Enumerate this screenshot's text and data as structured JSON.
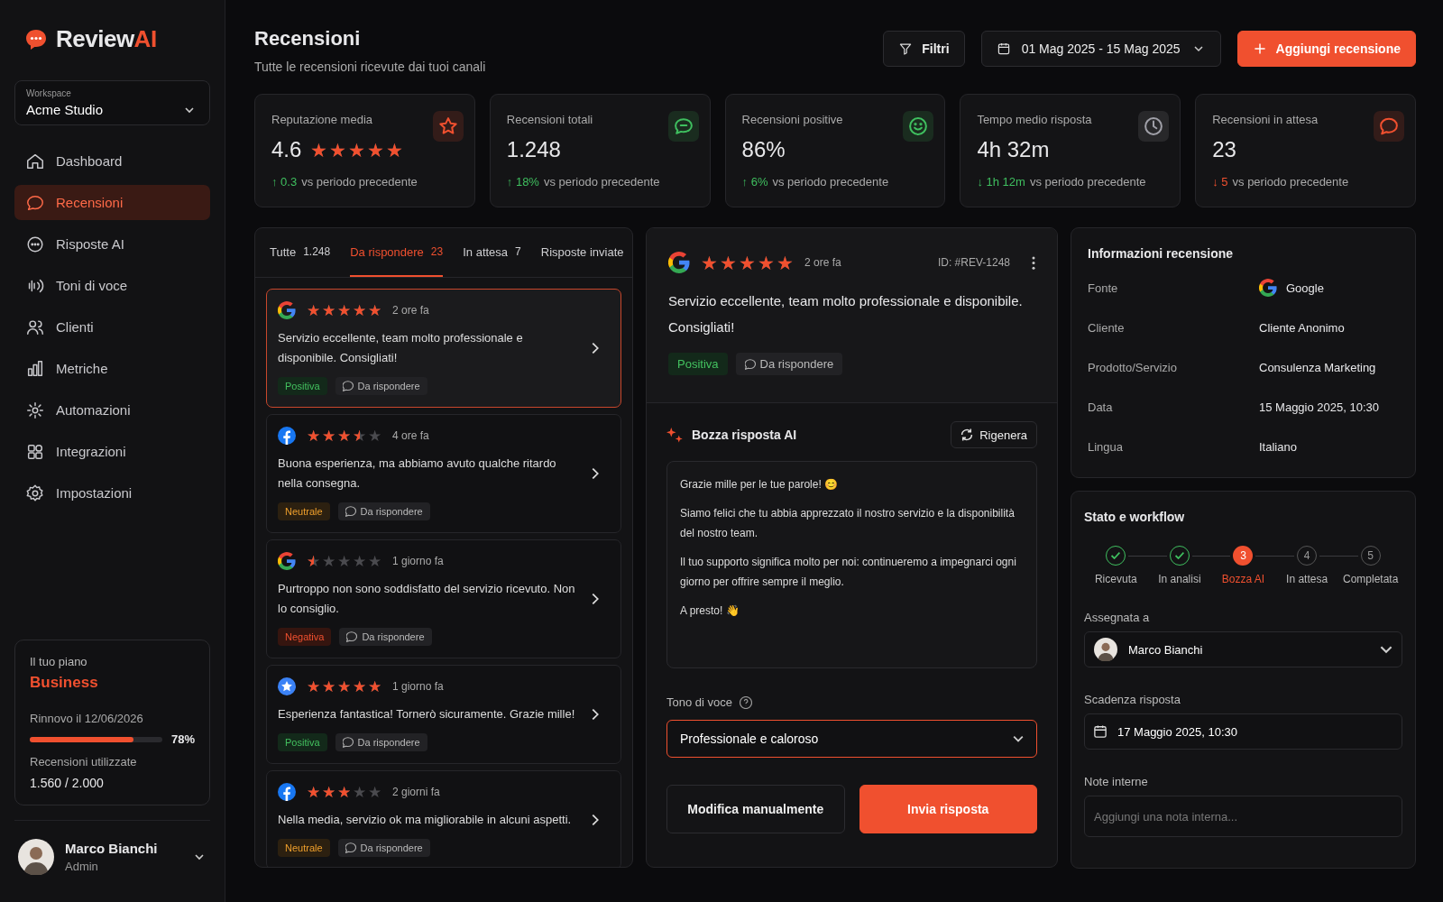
{
  "brand": {
    "name": "Review",
    "accent": "AI"
  },
  "workspace": {
    "label": "Workspace",
    "value": "Acme Studio"
  },
  "nav": [
    {
      "label": "Dashboard",
      "selected": false
    },
    {
      "label": "Recensioni",
      "selected": true
    },
    {
      "label": "Risposte AI",
      "selected": false
    },
    {
      "label": "Toni di voce",
      "selected": false
    },
    {
      "label": "Clienti",
      "selected": false
    },
    {
      "label": "Metriche",
      "selected": false
    },
    {
      "label": "Automazioni",
      "selected": false
    },
    {
      "label": "Integrazioni",
      "selected": false
    },
    {
      "label": "Impostazioni",
      "selected": false
    }
  ],
  "plan": {
    "label": "Il tuo piano",
    "name": "Business",
    "renewal": "Rinnovo il 12/06/2026",
    "level": 0.78,
    "percent": "78%",
    "usage_label": "Recensioni utilizzate",
    "usage": "1.560 / 2.000"
  },
  "user": {
    "name": "Marco Bianchi",
    "role": "Admin"
  },
  "header": {
    "title": "Recensioni",
    "subtitle": "Tutte le recensioni ricevute dai tuoi canali",
    "filter": "Filtri",
    "date_range": "01 Mag 2025 - 15 Mag 2025",
    "add": "Aggiungi recensione"
  },
  "stats": [
    {
      "label": "Reputazione media",
      "value": "4.6",
      "stars": 5,
      "icon": {
        "color": "#f0502f"
      },
      "delta": {
        "arrow": "↑",
        "text": "0.3",
        "color": "#3fbf5f"
      },
      "note": "vs periodo precedente"
    },
    {
      "label": "Recensioni totali",
      "value": "1.248",
      "icon": {
        "color": "#3fbf5f"
      },
      "delta": {
        "arrow": "↑",
        "text": "18%",
        "color": "#3fbf5f"
      },
      "note": "vs periodo precedente"
    },
    {
      "label": "Recensioni positive",
      "value": "86%",
      "icon": {
        "color": "#3fbf5f"
      },
      "delta": {
        "arrow": "↑",
        "text": "6%",
        "color": "#3fbf5f"
      },
      "note": "vs periodo precedente"
    },
    {
      "label": "Tempo medio risposta",
      "value": "4h 32m",
      "icon": {
        "color": "#a0a0a8"
      },
      "delta": {
        "arrow": "↓",
        "text": "1h 12m",
        "color": "#3fbf5f"
      },
      "note": "vs periodo precedente"
    },
    {
      "label": "Recensioni in attesa",
      "value": "23",
      "icon": {
        "color": "#f0502f"
      },
      "delta": {
        "arrow": "↓",
        "text": "5",
        "color": "#f0502f"
      },
      "note": "vs periodo precedente"
    }
  ],
  "tabs": [
    {
      "label": "Tutte",
      "count": "1.248",
      "selected": false
    },
    {
      "label": "Da rispondere",
      "count": "23",
      "selected": true
    },
    {
      "label": "In attesa",
      "count": "7",
      "selected": false
    },
    {
      "label": "Risposte inviate",
      "selected": false
    }
  ],
  "reviews": [
    {
      "source": {
        "kind": "google"
      },
      "stars": 5,
      "time": "2 ore fa",
      "text": "Servizio eccellente, team molto professionale e disponibile. Consigliati!",
      "tag": {
        "kind": "positive",
        "text": "Positiva"
      },
      "status": "Da rispondere",
      "selected": true
    },
    {
      "source": {
        "kind": "facebook"
      },
      "stars": 3.5,
      "time": "4 ore fa",
      "text": "Buona esperienza, ma abbiamo avuto qualche ritardo nella consegna.",
      "tag": {
        "kind": "neutral",
        "text": "Neutrale"
      },
      "status": "Da rispondere",
      "selected": false
    },
    {
      "source": {
        "kind": "google"
      },
      "stars": 0.5,
      "time": "1 giorno fa",
      "text": "Purtroppo non sono soddisfatto del servizio ricevuto. Non lo consiglio.",
      "tag": {
        "kind": "negative",
        "text": "Negativa"
      },
      "status": "Da rispondere",
      "selected": false
    },
    {
      "source": {
        "kind": "star"
      },
      "stars": 5,
      "time": "1 giorno fa",
      "text": "Esperienza fantastica! Tornerò sicuramente. Grazie mille!",
      "tag": {
        "kind": "positive",
        "text": "Positiva"
      },
      "status": "Da rispondere",
      "selected": false
    },
    {
      "source": {
        "kind": "facebook"
      },
      "stars": 3,
      "time": "2 giorni fa",
      "text": "Nella media, servizio ok ma migliorabile in alcuni aspetti.",
      "tag": {
        "kind": "neutral",
        "text": "Neutrale"
      },
      "status": "Da rispondere",
      "selected": false
    }
  ],
  "detail": {
    "source": {
      "kind": "google"
    },
    "stars": 5,
    "time": "2 ore fa",
    "id": "ID: #REV-1248",
    "text": "Servizio eccellente, team molto professionale e disponibile. Consigliati!",
    "tag": {
      "kind": "positive",
      "text": "Positiva"
    },
    "status": "Da rispondere"
  },
  "draft": {
    "title": "Bozza risposta AI",
    "regenerate": "Rigenera",
    "paragraphs": [
      "Grazie mille per le tue parole! 😊",
      "Siamo felici che tu abbia apprezzato il nostro servizio e la disponibilità del nostro team.",
      "Il tuo supporto significa molto per noi: continueremo a impegnarci ogni giorno per offrire sempre il meglio.",
      "A presto! 👋"
    ],
    "tone_label": "Tono di voce",
    "tone": "Professionale e caloroso",
    "edit": "Modifica manualmente",
    "send": "Invia risposta"
  },
  "info": {
    "title": "Informazioni recensione",
    "rows": [
      {
        "label": "Fonte",
        "value": "Google",
        "kind": "google"
      },
      {
        "label": "Cliente",
        "value": "Cliente Anonimo",
        "kind": "text"
      },
      {
        "label": "Prodotto/Servizio",
        "value": "Consulenza Marketing",
        "kind": "text"
      },
      {
        "label": "Data",
        "value": "15 Maggio 2025, 10:30",
        "kind": "text"
      },
      {
        "label": "Lingua",
        "value": "Italiano",
        "kind": "text"
      }
    ]
  },
  "workflow": {
    "title": "Stato e workflow",
    "steps": [
      {
        "label": "Ricevuta",
        "kind": "done"
      },
      {
        "label": "In analisi",
        "kind": "done"
      },
      {
        "label": "Bozza AI",
        "number": "3",
        "kind": "current"
      },
      {
        "label": "In attesa",
        "number": "4",
        "kind": "pending"
      },
      {
        "label": "Completata",
        "number": "5",
        "kind": "pending"
      }
    ],
    "assigned_label": "Assegnata a",
    "assigned": "Marco Bianchi",
    "deadline_label": "Scadenza risposta",
    "deadline": "17 Maggio 2025, 10:30",
    "notes_label": "Note interne",
    "notes_placeholder": "Aggiungi una nota interna..."
  }
}
